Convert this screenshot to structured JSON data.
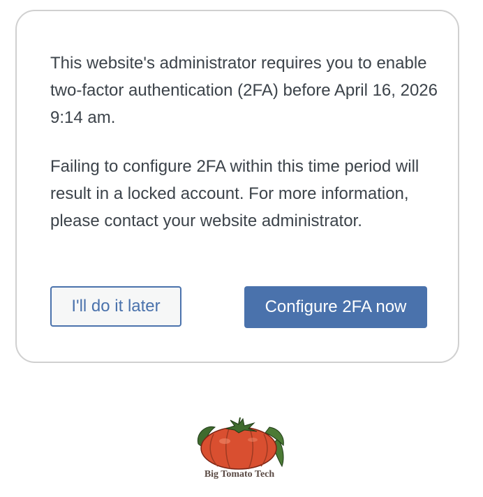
{
  "notice": {
    "paragraph_1": "This website's administrator requires you to enable two-factor authentication (2FA) before April 16, 2026 9:14 am.",
    "paragraph_2": "Failing to configure 2FA within this time period will result in a locked account. For more information, please contact your website administrator."
  },
  "actions": {
    "later_label": "I'll do it later",
    "configure_label": "Configure 2FA now"
  },
  "brand": {
    "logo_text": "Big Tomato Tech",
    "logo_icon": "tomato-icon"
  },
  "colors": {
    "accent": "#4a72ac",
    "text": "#3c434a",
    "card_border": "#d0d0d0",
    "secondary_button_bg": "#f6f7f7"
  }
}
